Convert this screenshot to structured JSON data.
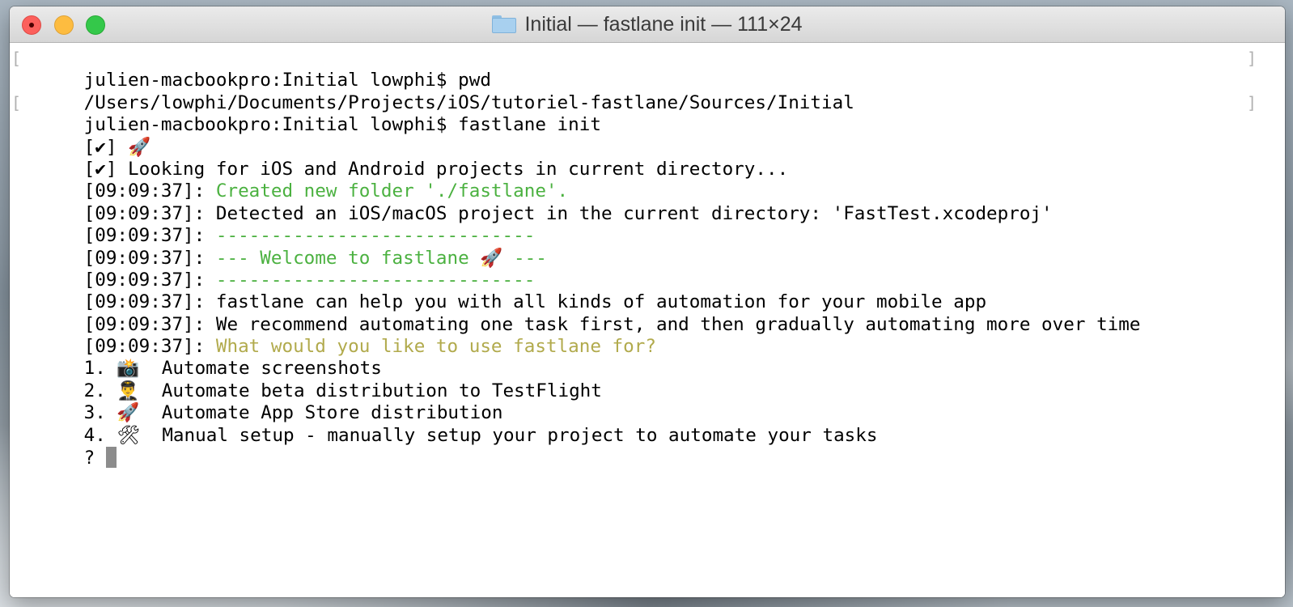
{
  "window": {
    "title": "Initial — fastlane init — 111×24",
    "title_icon": "folder-icon"
  },
  "colors": {
    "success_green": "#4bb140",
    "prompt_yellow": "#b1aa4c",
    "cursor_gray": "#8c8c8c"
  },
  "terminal": {
    "prompt_1": "julien-macbookpro:Initial lowphi$ pwd",
    "output_pwd": "/Users/lowphi/Documents/Projects/iOS/tutoriel-fastlane/Sources/Initial",
    "prompt_2": "julien-macbookpro:Initial lowphi$ fastlane init",
    "check_1": "[✔] 🚀",
    "check_2": "[✔] Looking for iOS and Android projects in current directory...",
    "ts": "[09:09:37]: ",
    "msg_created": "Created new folder './fastlane'.",
    "msg_detected": "Detected an iOS/macOS project in the current directory: 'FastTest.xcodeproj'",
    "msg_rule_1": "-----------------------------",
    "msg_welcome": "--- Welcome to fastlane 🚀 ---",
    "msg_rule_2": "-----------------------------",
    "msg_help": "fastlane can help you with all kinds of automation for your mobile app",
    "msg_recommend": "We recommend automating one task first, and then gradually automating more over time",
    "msg_question": "What would you like to use fastlane for?",
    "options": [
      "1. 📸  Automate screenshots",
      "2. 👨‍✈️  Automate beta distribution to TestFlight",
      "3. 🚀  Automate App Store distribution",
      "4. 🛠  Manual setup - manually setup your project to automate your tasks"
    ],
    "input_prompt": "? "
  }
}
